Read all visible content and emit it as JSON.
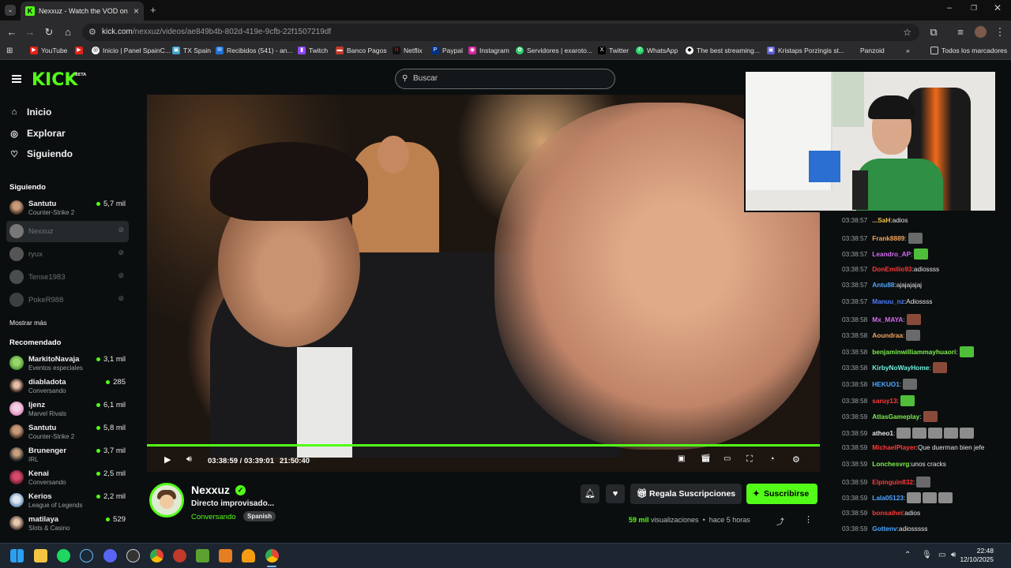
{
  "browser": {
    "tab_title": "Nexxuz - Watch the VOD on Kick",
    "url_host": "kick.com",
    "url_path": "/nexxuz/videos/ae849b4b-802d-419e-9cfb-22f1507219df",
    "bookmarks": [
      "YouTube",
      "",
      "Inicio | Panel SpainC...",
      "TX Spain",
      "Recibidos (541) - an...",
      "Twitch",
      "Banco Pagos",
      "Netflix",
      "Paypal",
      "Instagram",
      "Servidores | exaroto...",
      "Twitter",
      "WhatsApp",
      "The best streaming...",
      "Kristaps Porzingis st...",
      "Panzoid"
    ],
    "bookmarks_overflow": "»",
    "all_bookmarks": "Todos los marcadores"
  },
  "header": {
    "logo": "KICK",
    "beta": "BETA",
    "search_placeholder": "Buscar"
  },
  "sidebar": {
    "nav": [
      {
        "label": "Inicio",
        "icon": "home-icon"
      },
      {
        "label": "Explorar",
        "icon": "compass-icon"
      },
      {
        "label": "Siguiendo",
        "icon": "heart-icon"
      }
    ],
    "following_title": "Siguiendo",
    "following": [
      {
        "name": "Santutu",
        "category": "Counter-Strike 2",
        "viewers": "5,7 mil",
        "live": true
      },
      {
        "name": "Nexxuz",
        "category": "",
        "viewers": "",
        "live": false
      },
      {
        "name": "ryux",
        "category": "",
        "viewers": "",
        "live": false
      },
      {
        "name": "Tense1983",
        "category": "",
        "viewers": "",
        "live": false
      },
      {
        "name": "PokeR988",
        "category": "",
        "viewers": "",
        "live": false
      }
    ],
    "show_more": "Mostrar más",
    "recommended_title": "Recomendado",
    "recommended": [
      {
        "name": "MarkitoNavaja",
        "category": "Eventos especiales",
        "viewers": "3,1 mil"
      },
      {
        "name": "diabladota",
        "category": "Conversando",
        "viewers": "285"
      },
      {
        "name": "ljenz",
        "category": "Marvel Rivals",
        "viewers": "6,1 mil"
      },
      {
        "name": "Santutu",
        "category": "Counter-Strike 2",
        "viewers": "5,8 mil"
      },
      {
        "name": "Brunenger",
        "category": "IRL",
        "viewers": "3,7 mil"
      },
      {
        "name": "Kenai",
        "category": "Conversando",
        "viewers": "2,5 mil"
      },
      {
        "name": "Kerios",
        "category": "League of Legends",
        "viewers": "2,2 mil"
      },
      {
        "name": "matilaya",
        "category": "Slots & Casino",
        "viewers": "529"
      }
    ]
  },
  "player": {
    "current_time": "03:38:59",
    "duration": "03:39:01",
    "clock": "21:50:40",
    "progress": 0.9998
  },
  "stream": {
    "name": "Nexxuz",
    "title": "Directo improvisado...",
    "category": "Conversando",
    "language": "Spanish",
    "gift_label": "Regala Suscripciones",
    "subscribe_label": "Suscribirse",
    "views_count": "59 mil",
    "views_label": "visualizaciones",
    "ago": "hace 5 horas"
  },
  "chat": [
    {
      "time": "03:38:57",
      "user": "...SaH",
      "color": "#f0c24b",
      "text": "adios",
      "emotes": 0
    },
    {
      "time": "03:38:57",
      "user": "Frank8889",
      "color": "#f2a65a",
      "text": "",
      "emotes": 1
    },
    {
      "time": "03:38:57",
      "user": "Leandro_AP",
      "color": "#d46cf0",
      "text": "",
      "emotes": 1
    },
    {
      "time": "03:38:57",
      "user": "DonEmilio93",
      "color": "#ff3b3b",
      "text": "adiossss",
      "emotes": 0
    },
    {
      "time": "03:38:57",
      "user": "Antu88",
      "color": "#4fa6ff",
      "text": "ajajajajaj",
      "emotes": 0
    },
    {
      "time": "03:38:57",
      "user": "Manuu_nz",
      "color": "#4f7dff",
      "text": "Adiossss",
      "emotes": 0
    },
    {
      "time": "03:38:58",
      "user": "Mx_MAYA",
      "color": "#d46cf0",
      "text": "",
      "emotes": 1
    },
    {
      "time": "03:38:58",
      "user": "Aoundraa",
      "color": "#f2a65a",
      "text": "",
      "emotes": 1
    },
    {
      "time": "03:38:58",
      "user": "benjaminwilliammayhuaori",
      "color": "#7cf04b",
      "text": "",
      "emotes": 1
    },
    {
      "time": "03:38:58",
      "user": "KirbyNoWayHome",
      "color": "#6ef0e0",
      "text": "",
      "emotes": 1
    },
    {
      "time": "03:38:58",
      "user": "HEKUO1",
      "color": "#4fa6ff",
      "text": "",
      "emotes": 1
    },
    {
      "time": "03:38:58",
      "user": "saruy13",
      "color": "#ff3b3b",
      "text": "",
      "emotes": 1
    },
    {
      "time": "03:38:59",
      "user": "AtlasGameplay",
      "color": "#7cf04b",
      "text": "",
      "emotes": 1
    },
    {
      "time": "03:38:59",
      "user": "atheo1",
      "color": "#e6e6e6",
      "text": "",
      "emotes": 5
    },
    {
      "time": "03:38:59",
      "user": "MichaelPlayer",
      "color": "#ff3b3b",
      "text": "Que duerman bien jefe",
      "emotes": 0
    },
    {
      "time": "03:38:59",
      "user": "Lonchesvrg",
      "color": "#7cf04b",
      "text": "unos cracks",
      "emotes": 0
    },
    {
      "time": "03:38:59",
      "user": "Elpinguin832",
      "color": "#ff3b3b",
      "text": "",
      "emotes": 1
    },
    {
      "time": "03:38:59",
      "user": "Lala05123",
      "color": "#4fa6ff",
      "text": "",
      "emotes": 3
    },
    {
      "time": "03:38:59",
      "user": "bonsaihei",
      "color": "#ff3b3b",
      "text": "adios",
      "emotes": 0
    },
    {
      "time": "03:38:59",
      "user": "Gottenv",
      "color": "#4fa6ff",
      "text": "adiosssss",
      "emotes": 0
    }
  ],
  "taskbar": {
    "time": "22:48",
    "date": "12/10/2025"
  },
  "colors": {
    "accent": "#53fc18",
    "background": "#0b0e0f",
    "surface": "#26292c"
  }
}
